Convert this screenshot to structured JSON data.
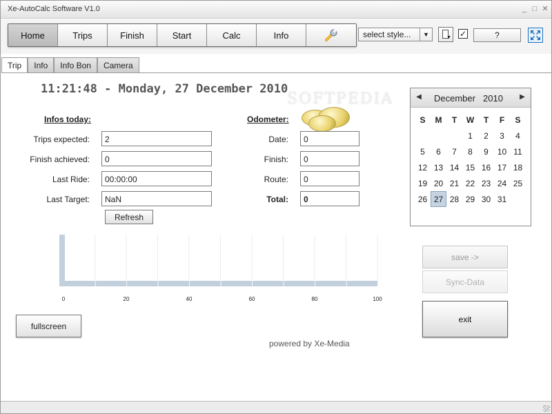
{
  "window": {
    "title": "Xe-AutoCalc Software V1.0",
    "minimize": "_",
    "maximize": "□",
    "close": "✕"
  },
  "toolbar": {
    "nav": [
      {
        "label": "Home",
        "active": true
      },
      {
        "label": "Trips",
        "active": false
      },
      {
        "label": "Finish",
        "active": false
      },
      {
        "label": "Start",
        "active": false
      },
      {
        "label": "Calc",
        "active": false
      },
      {
        "label": "Info",
        "active": false
      }
    ],
    "tools_icon": "wrench-icon",
    "style_select": "select style...",
    "checked": true,
    "help_label": "?",
    "fullscreen_icon": "expand-icon"
  },
  "tabs": [
    {
      "label": "Trip",
      "active": true
    },
    {
      "label": "Info",
      "active": false
    },
    {
      "label": "Info Bon",
      "active": false
    },
    {
      "label": "Camera",
      "active": false
    }
  ],
  "clock": "11:21:48 - Monday, 27 December 2010",
  "infos_today": {
    "title": "Infos today:",
    "trips_expected_label": "Trips expected:",
    "trips_expected_value": "2",
    "finish_achieved_label": "Finish achieved:",
    "finish_achieved_value": "0",
    "last_ride_label": "Last Ride:",
    "last_ride_value": "00:00:00",
    "last_target_label": "Last Target:",
    "last_target_value": "NaN",
    "refresh_label": "Refresh"
  },
  "odometer": {
    "title": "Odometer:",
    "date_label": "Date:",
    "date_value": "0",
    "finish_label": "Finish:",
    "finish_value": "0",
    "route_label": "Route:",
    "route_value": "0",
    "total_label": "Total:",
    "total_value": "0"
  },
  "watermark": {
    "text": "SOFTPEDIA"
  },
  "calendar": {
    "month": "December",
    "year": "2010",
    "prev": "◀",
    "next": "▶",
    "dow": [
      "S",
      "M",
      "T",
      "W",
      "T",
      "F",
      "S"
    ],
    "leading_blanks": 3,
    "days": [
      "1",
      "2",
      "3",
      "4",
      "5",
      "6",
      "7",
      "8",
      "9",
      "10",
      "11",
      "12",
      "13",
      "14",
      "15",
      "16",
      "17",
      "18",
      "19",
      "20",
      "21",
      "22",
      "23",
      "24",
      "25",
      "26",
      "27",
      "28",
      "29",
      "30",
      "31"
    ],
    "selected": "27"
  },
  "chart_data": {
    "type": "bar",
    "x_ticks": [
      0,
      20,
      40,
      60,
      80,
      100
    ],
    "xlim": [
      0,
      100
    ],
    "values": [
      10,
      0,
      0,
      0,
      0,
      0,
      0,
      0,
      0,
      0,
      0
    ],
    "bar_color": "#c2d0de"
  },
  "buttons": {
    "save": "save ->",
    "sync": "Sync-Data",
    "exit": "exit",
    "fullscreen": "fullscreen"
  },
  "footer": {
    "powered_by": "powered by Xe-Media"
  }
}
